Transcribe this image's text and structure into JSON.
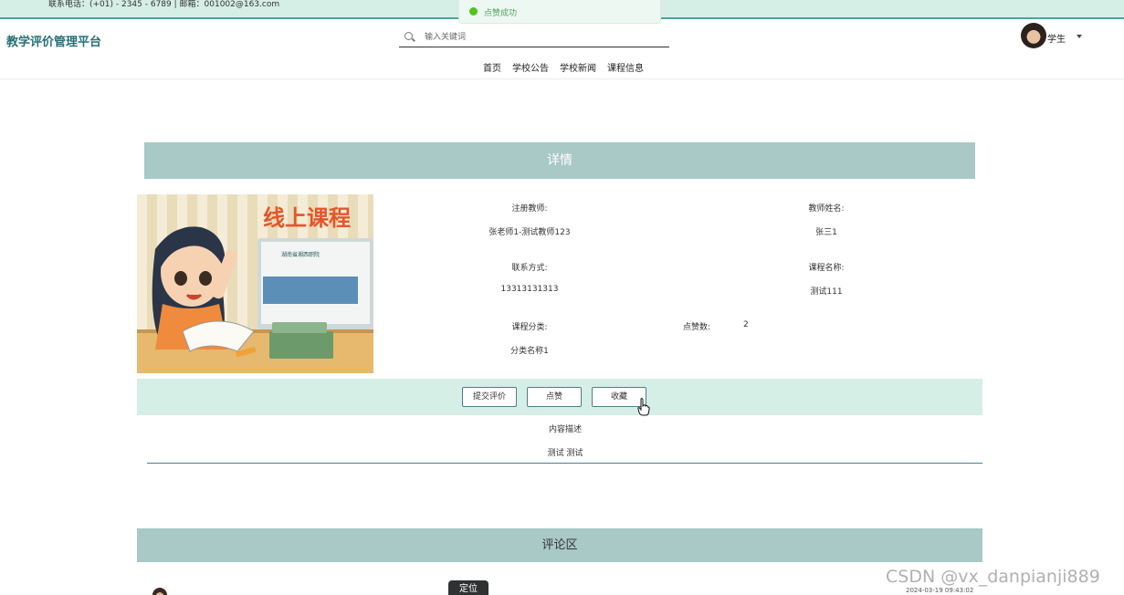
{
  "topbar": {
    "contact": "联系电话：(+01) - 2345 - 6789 | 邮箱：001002@163.com"
  },
  "toast": {
    "message": "点赞成功",
    "icon": "success-check-icon",
    "color": "#52c41a"
  },
  "header": {
    "brand": "教学评价管理平台",
    "search_placeholder": "输入关键词",
    "user_name": "学生"
  },
  "nav": {
    "items": [
      {
        "label": "首页"
      },
      {
        "label": "学校公告"
      },
      {
        "label": "学校新闻"
      },
      {
        "label": "课程信息"
      }
    ]
  },
  "detail": {
    "title": "详情",
    "image_text": "线上课程",
    "image_screen_text": "湖南省湘西职院",
    "fields": {
      "registered_teacher_label": "注册教师:",
      "registered_teacher_value": "张老师1-测试教师123",
      "teacher_name_label": "教师姓名:",
      "teacher_name_value": "张三1",
      "contact_label": "联系方式:",
      "contact_value": "13313131313",
      "course_name_label": "课程名称:",
      "course_name_value": "测试111",
      "category_label": "课程分类:",
      "category_value": "分类名称1",
      "likes_label": "点赞数:",
      "likes_value": "2"
    },
    "actions": {
      "submit_review": "提交评价",
      "like": "点赞",
      "favorite": "收藏"
    },
    "description_label": "内容描述",
    "description_value": "测试 测试"
  },
  "comments": {
    "title": "评论区",
    "tooltip": "定位",
    "timestamp": "2024-03-19 09:43:02"
  },
  "watermark": "CSDN @vx_danpianji889",
  "colors": {
    "accent": "#a8c9c5",
    "topbar": "#d5eee6",
    "brand": "#2a6f78"
  }
}
